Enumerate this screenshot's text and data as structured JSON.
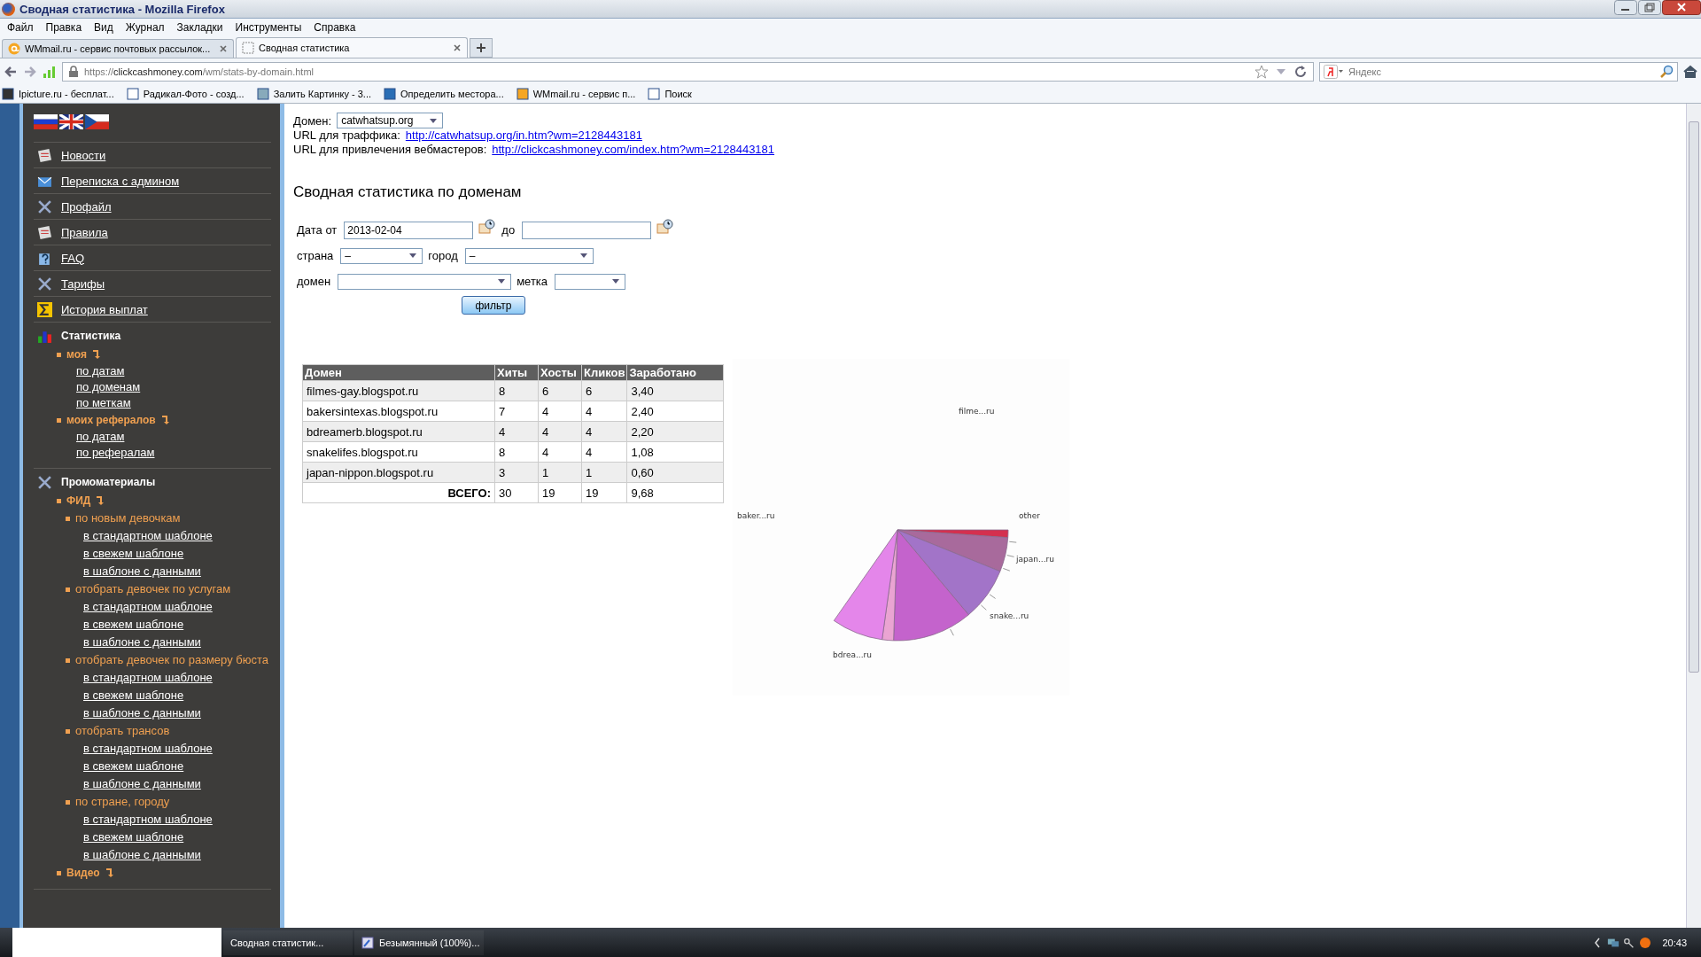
{
  "window": {
    "title": "Сводная статистика - Mozilla Firefox"
  },
  "menu": [
    "Файл",
    "Правка",
    "Вид",
    "Журнал",
    "Закладки",
    "Инструменты",
    "Справка"
  ],
  "tabs": [
    {
      "label": "WMmail.ru - сервис почтовых рассылок...",
      "selected": false
    },
    {
      "label": "Сводная статистика",
      "selected": true
    }
  ],
  "address_bar": {
    "url_prefix": "https://",
    "url_domain": "clickcashmoney.com",
    "url_path": "/wm/stats-by-domain.html"
  },
  "search": {
    "placeholder": "Яндекс"
  },
  "bookmarks": [
    "Ipicture.ru - бесплат...",
    "Радикал-Фото - созд...",
    "Залить Картинку - 3...",
    "Определить местора...",
    "WMmail.ru - сервис п...",
    "Поиск"
  ],
  "sidebar": {
    "items": [
      {
        "label": "Новости",
        "kind": "link"
      },
      {
        "label": "Переписка с админом",
        "kind": "link"
      },
      {
        "label": "Профайл",
        "kind": "link"
      },
      {
        "label": "Правила",
        "kind": "link"
      },
      {
        "label": "FAQ",
        "kind": "link"
      },
      {
        "label": "Тарифы",
        "kind": "link"
      },
      {
        "label": "История выплат",
        "kind": "link"
      },
      {
        "label": "Статистика",
        "kind": "section",
        "children": [
          {
            "label": "моя",
            "kind": "group",
            "children": [
              {
                "label": "по датам"
              },
              {
                "label": "по доменам"
              },
              {
                "label": "по меткам"
              }
            ]
          },
          {
            "label": "моих рефералов",
            "kind": "group",
            "children": [
              {
                "label": "по датам"
              },
              {
                "label": "по рефералам"
              }
            ]
          }
        ]
      },
      {
        "label": "Промоматериалы",
        "kind": "section",
        "children": [
          {
            "label": "ФИД",
            "kind": "group",
            "children": [
              {
                "label": "по новым девочкам",
                "kind": "subgroup",
                "children": [
                  {
                    "label": "в стандартном шаблоне"
                  },
                  {
                    "label": "в свежем шаблоне"
                  },
                  {
                    "label": "в шаблоне с данными"
                  }
                ]
              },
              {
                "label": "отобрать девочек по услугам",
                "kind": "subgroup",
                "children": [
                  {
                    "label": "в стандартном шаблоне"
                  },
                  {
                    "label": "в свежем шаблоне"
                  },
                  {
                    "label": "в шаблоне с данными"
                  }
                ]
              },
              {
                "label": "отобрать девочек по размеру бюста",
                "kind": "subgroup",
                "children": [
                  {
                    "label": "в стандартном шаблоне"
                  },
                  {
                    "label": "в свежем шаблоне"
                  },
                  {
                    "label": "в шаблоне с данными"
                  }
                ]
              },
              {
                "label": "отобрать трансов",
                "kind": "subgroup",
                "children": [
                  {
                    "label": "в стандартном шаблоне"
                  },
                  {
                    "label": "в свежем шаблоне"
                  },
                  {
                    "label": "в шаблоне с данными"
                  }
                ]
              },
              {
                "label": "по стране, городу",
                "kind": "subgroup",
                "children": [
                  {
                    "label": "в стандартном шаблоне"
                  },
                  {
                    "label": "в свежем шаблоне"
                  },
                  {
                    "label": "в шаблоне с данными"
                  }
                ]
              }
            ]
          },
          {
            "label": "Видео",
            "kind": "group"
          }
        ]
      }
    ]
  },
  "domain_select": {
    "label": "Домен:",
    "value": "catwhatsup.org"
  },
  "url_lines": [
    {
      "label": "URL для траффика:",
      "link": "http://catwhatsup.org/in.htm?wm=2128443181"
    },
    {
      "label": "URL для привлечения вебмастеров:",
      "link": "http://clickcashmoney.com/index.htm?wm=2128443181"
    }
  ],
  "heading": "Сводная статистика по доменам",
  "filter": {
    "date_from": {
      "label": "Дата от",
      "value": "2013-02-04"
    },
    "date_to": {
      "label": "до"
    },
    "country": {
      "label": "страна",
      "value": "–"
    },
    "city": {
      "label": "город",
      "value": "–"
    },
    "domain": {
      "label": "домен"
    },
    "tag": {
      "label": "метка"
    },
    "button": "фильтр"
  },
  "table": {
    "columns": [
      "Домен",
      "Хиты",
      "Хосты",
      "Кликов",
      "Заработано"
    ],
    "rows": [
      [
        "filmes-gay.blogspot.ru",
        "8",
        "6",
        "6",
        "3,40"
      ],
      [
        "bakersintexas.blogspot.ru",
        "7",
        "4",
        "4",
        "2,40"
      ],
      [
        "bdreamerb.blogspot.ru",
        "4",
        "4",
        "4",
        "2,20"
      ],
      [
        "snakelifes.blogspot.ru",
        "8",
        "4",
        "4",
        "1,08"
      ],
      [
        "japan-nippon.blogspot.ru",
        "3",
        "1",
        "1",
        "0,60"
      ]
    ],
    "total": {
      "label": "ВСЕГО:",
      "values": [
        "30",
        "19",
        "19",
        "9,68"
      ]
    }
  },
  "pie": {
    "labels": [
      "filme...ru",
      "baker...ru",
      "other",
      "japan...ru",
      "snake...ru",
      "bdrea...ru"
    ]
  },
  "taskbar": {
    "tasks": [
      "Сводная статистик...",
      "Безымянный (100%)..."
    ],
    "clock": "20:43"
  }
}
